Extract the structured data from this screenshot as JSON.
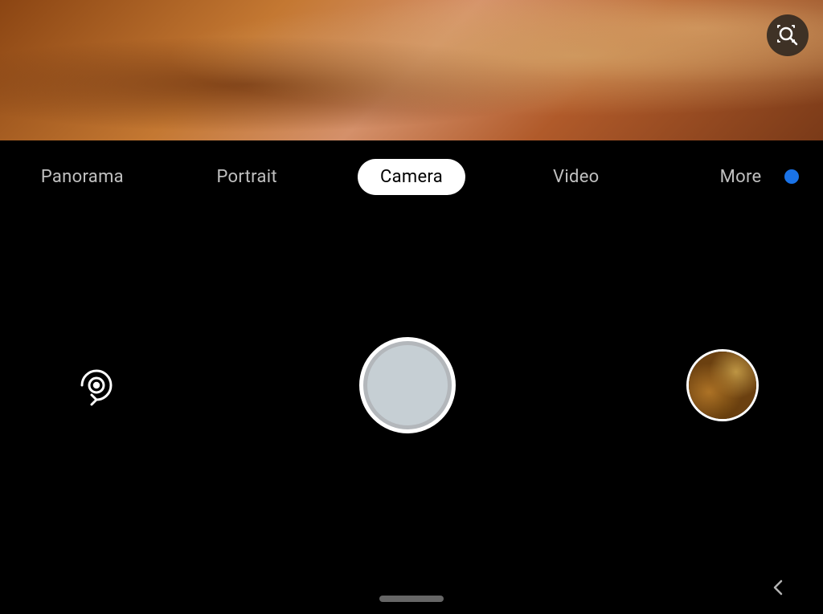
{
  "viewfinder": {
    "alt": "Camera viewfinder showing blurred warm tones"
  },
  "lens_button": {
    "label": "Google Lens",
    "icon": "lens-icon"
  },
  "modes": {
    "items": [
      {
        "id": "panorama",
        "label": "Panorama",
        "active": false
      },
      {
        "id": "portrait",
        "label": "Portrait",
        "active": false
      },
      {
        "id": "camera",
        "label": "Camera",
        "active": true
      },
      {
        "id": "video",
        "label": "Video",
        "active": false
      },
      {
        "id": "more",
        "label": "More",
        "active": false
      }
    ]
  },
  "blue_dot": {
    "color": "#1a73e8"
  },
  "controls": {
    "flip_label": "Flip Camera",
    "shutter_label": "Take Photo",
    "gallery_label": "Gallery"
  },
  "bottom": {
    "home_indicator": "Home",
    "back_label": "Back"
  }
}
